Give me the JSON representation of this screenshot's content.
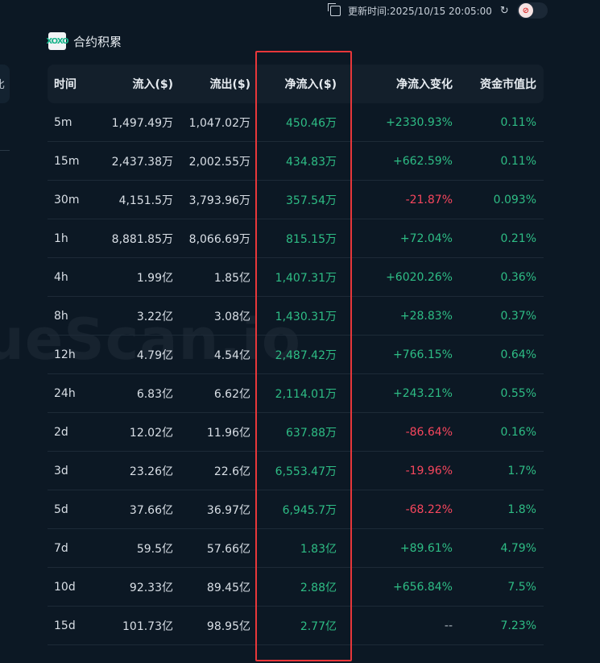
{
  "update_time": "更新时间:2025/10/15 20:05:00",
  "left_fragment": "比",
  "section_title": "合约积累",
  "logo_text": "XOXO",
  "watermark": "ueScan.io",
  "headers": [
    "时间",
    "流入($)",
    "流出($)",
    "净流入($)",
    "净流入变化",
    "资金市值比"
  ],
  "rows": [
    {
      "time": "5m",
      "inflow": "1,497.49万",
      "outflow": "1,047.02万",
      "net": "450.46万",
      "change": "+2330.93%",
      "dir": "up",
      "ratio": "0.11%"
    },
    {
      "time": "15m",
      "inflow": "2,437.38万",
      "outflow": "2,002.55万",
      "net": "434.83万",
      "change": "+662.59%",
      "dir": "up",
      "ratio": "0.11%"
    },
    {
      "time": "30m",
      "inflow": "4,151.5万",
      "outflow": "3,793.96万",
      "net": "357.54万",
      "change": "-21.87%",
      "dir": "down",
      "ratio": "0.093%"
    },
    {
      "time": "1h",
      "inflow": "8,881.85万",
      "outflow": "8,066.69万",
      "net": "815.15万",
      "change": "+72.04%",
      "dir": "up",
      "ratio": "0.21%"
    },
    {
      "time": "4h",
      "inflow": "1.99亿",
      "outflow": "1.85亿",
      "net": "1,407.31万",
      "change": "+6020.26%",
      "dir": "up",
      "ratio": "0.36%"
    },
    {
      "time": "8h",
      "inflow": "3.22亿",
      "outflow": "3.08亿",
      "net": "1,430.31万",
      "change": "+28.83%",
      "dir": "up",
      "ratio": "0.37%"
    },
    {
      "time": "12h",
      "inflow": "4.79亿",
      "outflow": "4.54亿",
      "net": "2,487.42万",
      "change": "+766.15%",
      "dir": "up",
      "ratio": "0.64%"
    },
    {
      "time": "24h",
      "inflow": "6.83亿",
      "outflow": "6.62亿",
      "net": "2,114.01万",
      "change": "+243.21%",
      "dir": "up",
      "ratio": "0.55%"
    },
    {
      "time": "2d",
      "inflow": "12.02亿",
      "outflow": "11.96亿",
      "net": "637.88万",
      "change": "-86.64%",
      "dir": "down",
      "ratio": "0.16%"
    },
    {
      "time": "3d",
      "inflow": "23.26亿",
      "outflow": "22.6亿",
      "net": "6,553.47万",
      "change": "-19.96%",
      "dir": "down",
      "ratio": "1.7%"
    },
    {
      "time": "5d",
      "inflow": "37.66亿",
      "outflow": "36.97亿",
      "net": "6,945.7万",
      "change": "-68.22%",
      "dir": "down",
      "ratio": "1.8%"
    },
    {
      "time": "7d",
      "inflow": "59.5亿",
      "outflow": "57.66亿",
      "net": "1.83亿",
      "change": "+89.61%",
      "dir": "up",
      "ratio": "4.79%"
    },
    {
      "time": "10d",
      "inflow": "92.33亿",
      "outflow": "89.45亿",
      "net": "2.88亿",
      "change": "+656.84%",
      "dir": "up",
      "ratio": "7.5%"
    },
    {
      "time": "15d",
      "inflow": "101.73亿",
      "outflow": "98.95亿",
      "net": "2.77亿",
      "change": "--",
      "dir": "flat",
      "ratio": "7.23%"
    }
  ],
  "colors": {
    "positive": "#2ebd85",
    "negative": "#f6465d",
    "highlight": "#e8373a",
    "background": "#0c1824"
  }
}
